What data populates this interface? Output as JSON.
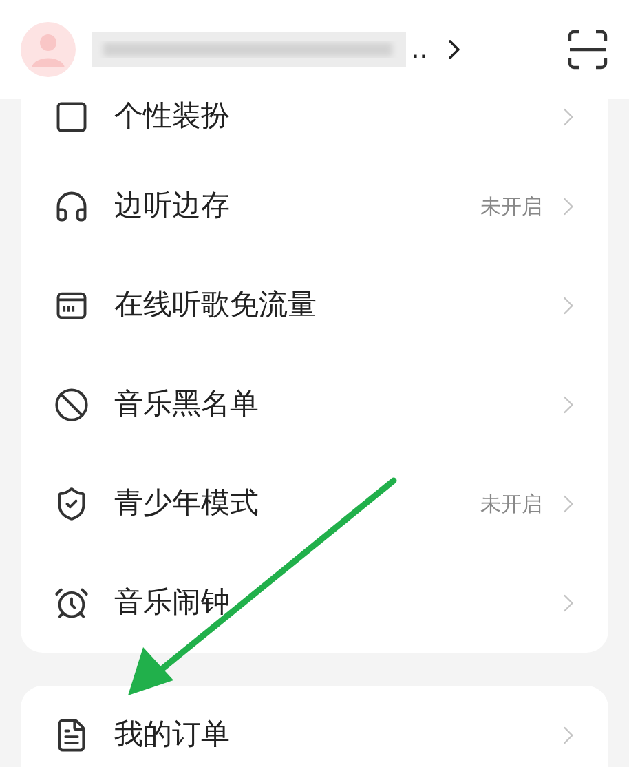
{
  "header": {
    "ellipsis": ".."
  },
  "sections": [
    {
      "items": [
        {
          "kind": "partial",
          "label": "个性装扮"
        },
        {
          "kind": "row",
          "label": "边听边存",
          "status": "未开启"
        },
        {
          "kind": "row",
          "label": "在线听歌免流量"
        },
        {
          "kind": "row",
          "label": "音乐黑名单"
        },
        {
          "kind": "row",
          "label": "青少年模式",
          "status": "未开启"
        },
        {
          "kind": "row",
          "label": "音乐闹钟"
        }
      ]
    },
    {
      "items": [
        {
          "kind": "row",
          "label": "我的订单"
        }
      ]
    }
  ]
}
